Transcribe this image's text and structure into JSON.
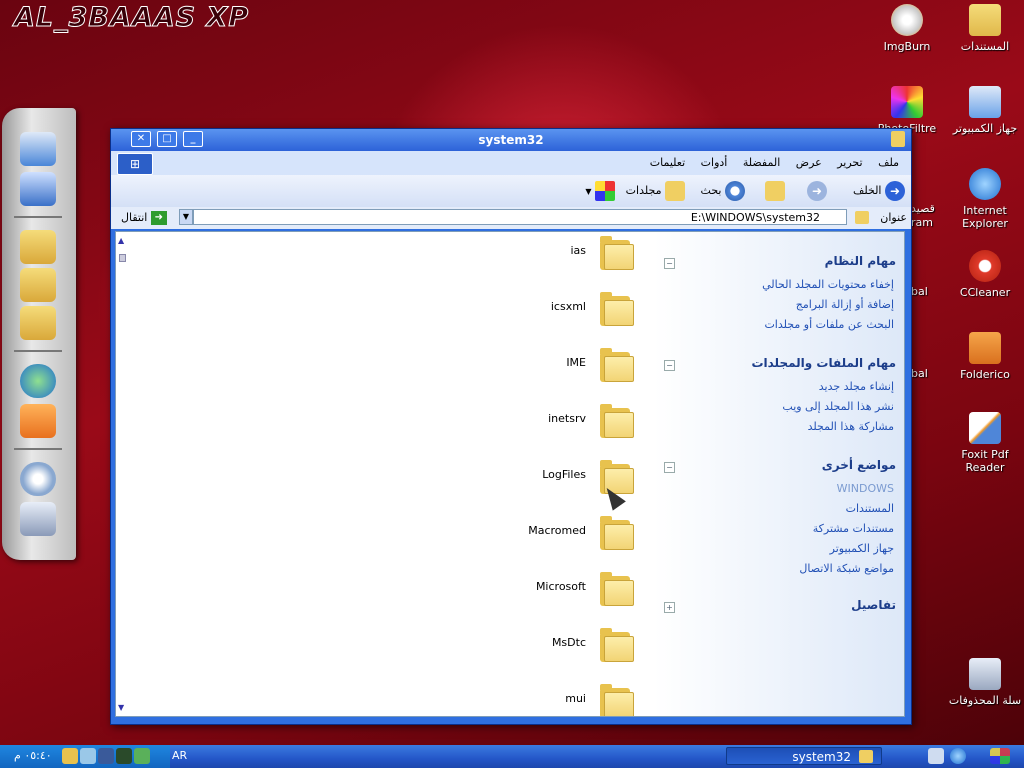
{
  "desktop": {
    "brand": "AL_3BAAAS XP",
    "icons": [
      {
        "name": "imgburn-icon",
        "label": "ImgBurn",
        "color": "#d8d8d8"
      },
      {
        "name": "documents-folder-icon",
        "label": "المستندات",
        "color": "#f0cf62"
      },
      {
        "name": "photofiltre-icon",
        "label": "PhotoFiltre",
        "color": "#e85a2a"
      },
      {
        "name": "my-computer-icon",
        "label": "جهاز الكمبيوتر",
        "color": "#6aa2e8"
      },
      {
        "name": "internet-explorer-icon",
        "label": "Internet Explorer",
        "color": "#2f7fe0"
      },
      {
        "name": "ccleaner-icon",
        "label": "CCleaner",
        "color": "#e03a2a"
      },
      {
        "name": "folderico-icon",
        "label": "Folderico",
        "color": "#e58a2e"
      },
      {
        "name": "foxit-pdf-reader-icon",
        "label": "Foxit Pdf Reader",
        "color": "#4f86d8"
      },
      {
        "name": "recycle-bin-icon",
        "label": "سلة المحذوفات",
        "color": "#b8c4d8"
      },
      {
        "name": "partial-icon-1",
        "label": "قصيد"
      },
      {
        "name": "partial-icon-2",
        "label": "ram"
      },
      {
        "name": "partial-icon-3",
        "label": "bal"
      },
      {
        "name": "partial-icon-4",
        "label": "bal"
      }
    ]
  },
  "window": {
    "title": "system32",
    "menu": [
      "ملف",
      "تحرير",
      "عرض",
      "المفضلة",
      "أدوات",
      "تعليمات"
    ],
    "toolbar": {
      "back": "الخلف",
      "search": "بحث",
      "folders": "مجلدات"
    },
    "address": {
      "label": "عنوان",
      "value": "E:\\WINDOWS\\system32",
      "go": "انتقال"
    },
    "taskpane": {
      "system_tasks": {
        "title": "مهام النظام",
        "links": [
          "إخفاء محتويات المجلد الحالي",
          "إضافة أو إزالة البرامج",
          "البحث عن ملفات أو مجلدات"
        ]
      },
      "file_tasks": {
        "title": "مهام الملفات والمجلدات",
        "links": [
          "إنشاء مجلد جديد",
          "نشر هذا المجلد إلى ويب",
          "مشاركة هذا المجلد"
        ]
      },
      "other_places": {
        "title": "مواضع أخرى",
        "links": [
          "WINDOWS",
          "المستندات",
          "مستندات مشتركة",
          "جهاز الكمبيوتر",
          "مواضع شبكة الاتصال"
        ]
      },
      "details": {
        "title": "تفاصيل"
      }
    },
    "folders": [
      "ias",
      "icsxml",
      "IME",
      "inetsrv",
      "LogFiles",
      "Macromed",
      "Microsoft",
      "MsDtc",
      "mui"
    ]
  },
  "taskbar": {
    "clock": "٠٥:٤٠ م",
    "language": "AR",
    "task_button": "system32"
  }
}
